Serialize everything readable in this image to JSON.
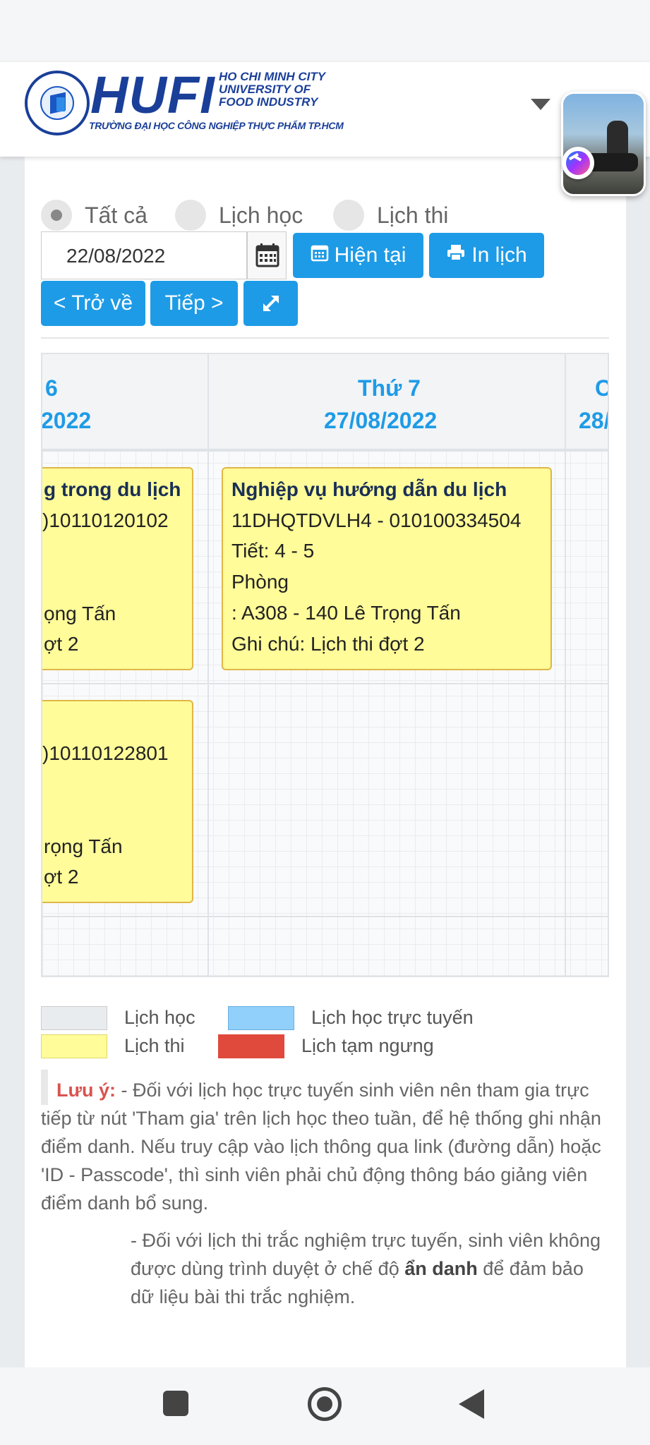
{
  "logo": {
    "name": "HUFI",
    "city_line1": "HO CHI MINH CITY",
    "city_line2": "UNIVERSITY OF",
    "city_line3": "FOOD INDUSTRY",
    "vn_name": "TRƯỜNG ĐẠI HỌC CÔNG NGHIỆP THỰC PHẨM TP.HCM"
  },
  "filter": {
    "options": [
      "Tất cả",
      "Lịch học",
      "Lịch thi"
    ],
    "selected": "Tất cả"
  },
  "toolbar": {
    "date_value": "22/08/2022",
    "now_label": "Hiện tại",
    "print_label": "In lịch",
    "back_label": "< Trở về",
    "next_label": "Tiếp >"
  },
  "calendar": {
    "columns": [
      {
        "day": "6",
        "date": "2022"
      },
      {
        "day": "Thứ 7",
        "date": "27/08/2022"
      },
      {
        "day": "C",
        "date": "28/"
      }
    ],
    "events": [
      {
        "title": "g trong du lịch",
        "code": ")10110120102",
        "tiet": "",
        "phong": "",
        "room": "ọng Tấn",
        "note": "ợt 2"
      },
      {
        "title": "Nghiệp vụ hướng dẫn du lịch",
        "code": "11DHQTDVLH4 - 010100334504",
        "tiet": "Tiết: 4 - 5",
        "phong": "Phòng",
        "room": ": A308 - 140 Lê Trọng Tấn",
        "note": "Ghi chú: Lịch thi đợt 2"
      },
      {
        "title": "",
        "code": ")10110122801",
        "tiet": "",
        "phong": "",
        "room": "rọng Tấn",
        "note": "ợt 2"
      }
    ]
  },
  "legend": [
    {
      "label": "Lịch học",
      "color": "#e9ecef"
    },
    {
      "label": "Lịch học trực tuyến",
      "color": "#90d0fb"
    },
    {
      "label": "Lịch thi",
      "color": "#fffc99"
    },
    {
      "label": "Lịch tạm ngưng",
      "color": "#e04a3c"
    }
  ],
  "notes": {
    "label": "Lưu ý:",
    "p1": " - Đối với lịch học trực tuyến sinh viên nên tham gia trực tiếp từ nút 'Tham gia' trên lịch học theo tuần, để hệ thống ghi nhận điểm danh. Nếu truy cập vào lịch thông qua link (đường dẫn) hoặc 'ID - Passcode', thì sinh viên phải chủ động thông báo giảng viên điểm danh bổ sung.",
    "p2_before": "- Đối với lịch thi trắc nghiệm trực tuyến, sinh viên không được dùng trình duyệt ở chế độ ",
    "p2_bold": "ẩn danh",
    "p2_after": " để đảm bảo dữ liệu bài thi trắc nghiệm."
  }
}
